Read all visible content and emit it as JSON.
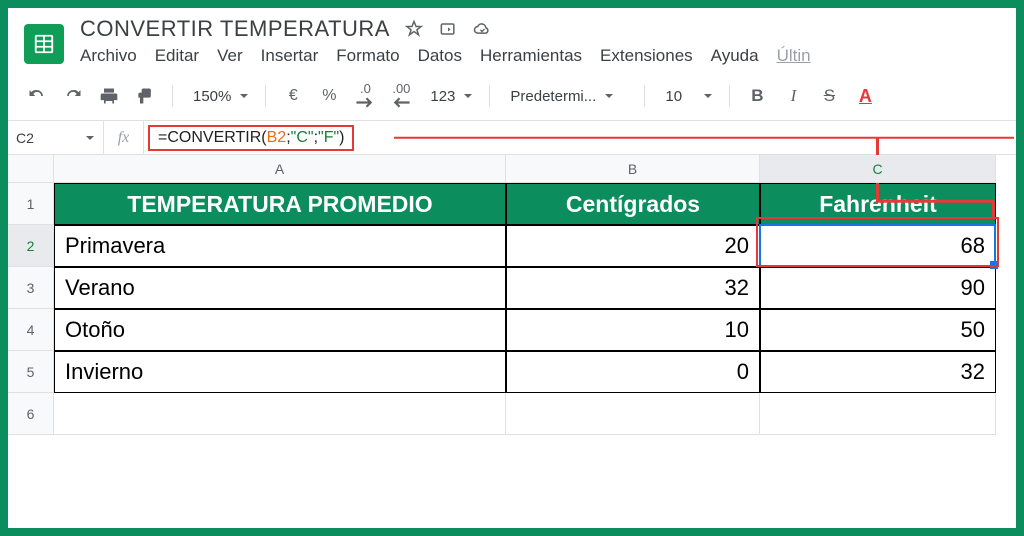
{
  "doc": {
    "title": "CONVERTIR TEMPERATURA"
  },
  "menu": {
    "archivo": "Archivo",
    "editar": "Editar",
    "ver": "Ver",
    "insertar": "Insertar",
    "formato": "Formato",
    "datos": "Datos",
    "herramientas": "Herramientas",
    "extensiones": "Extensiones",
    "ayuda": "Ayuda",
    "ultima": "Últin"
  },
  "toolbar": {
    "zoom": "150%",
    "currency": "€",
    "percent": "%",
    "dec_dec": ".0",
    "dec_inc": ".00",
    "numfmt": "123",
    "font": "Predetermi...",
    "size": "10",
    "bold": "B",
    "italic": "I",
    "strike": "S",
    "color": "A"
  },
  "formula": {
    "cellref": "C2",
    "fx": "fx",
    "eq": "=",
    "fn": "CONVERTIR",
    "open": "(",
    "arg1": "B2",
    "sep1": ";",
    "arg2": "\"C\"",
    "sep2": ";",
    "arg3": "\"F\"",
    "close": ")"
  },
  "cols": {
    "a": "A",
    "b": "B",
    "c": "C"
  },
  "rows": {
    "r1": "1",
    "r2": "2",
    "r3": "3",
    "r4": "4",
    "r5": "5",
    "r6": "6"
  },
  "data": {
    "header": {
      "a": "TEMPERATURA PROMEDIO",
      "b": "Centígrados",
      "c": "Fahrenheit"
    },
    "r2": {
      "a": "Primavera",
      "b": "20",
      "c": "68"
    },
    "r3": {
      "a": "Verano",
      "b": "32",
      "c": "90"
    },
    "r4": {
      "a": "Otoño",
      "b": "10",
      "c": "50"
    },
    "r5": {
      "a": "Invierno",
      "b": "0",
      "c": "32"
    }
  }
}
